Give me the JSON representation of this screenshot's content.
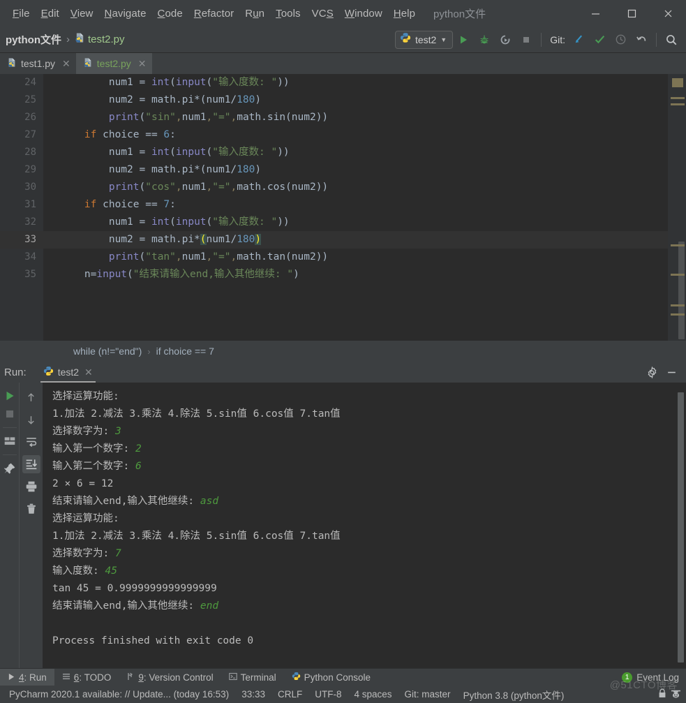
{
  "window": {
    "project_name": "python文件",
    "minimize_label": "Minimize",
    "maximize_label": "Maximize",
    "close_label": "Close"
  },
  "menu": [
    {
      "label": "File",
      "accel": "F"
    },
    {
      "label": "Edit",
      "accel": "E"
    },
    {
      "label": "View",
      "accel": "V"
    },
    {
      "label": "Navigate",
      "accel": "N"
    },
    {
      "label": "Code",
      "accel": "C"
    },
    {
      "label": "Refactor",
      "accel": "R"
    },
    {
      "label": "Run",
      "accel": "u"
    },
    {
      "label": "Tools",
      "accel": "T"
    },
    {
      "label": "VCS",
      "accel": "S"
    },
    {
      "label": "Window",
      "accel": "W"
    },
    {
      "label": "Help",
      "accel": "H"
    }
  ],
  "toolbar": {
    "breadcrumb_project": "python文件",
    "breadcrumb_sep": "›",
    "breadcrumb_file": "test2.py",
    "run_config_name": "test2",
    "run_config_caret": "▼",
    "git_label": "Git:",
    "buttons": {
      "run": "Run",
      "debug": "Debug",
      "run_coverage": "Run with Coverage",
      "stop": "Stop",
      "update_project": "Update Project",
      "commit": "Commit",
      "history": "History",
      "rollback": "Rollback",
      "search": "Search Everywhere"
    }
  },
  "editor_tabs": [
    {
      "label": "test1.py",
      "active": false,
      "close": "✕"
    },
    {
      "label": "test2.py",
      "active": true,
      "close": "✕"
    }
  ],
  "editor": {
    "first_line_number": 24,
    "current_line": 33,
    "lines": [
      {
        "n": 24,
        "html": "        num1 = int(input(\"输入度数: \"))",
        "clipped": true,
        "fold": "none"
      },
      {
        "n": 25,
        "html": "        num2 = math.pi*(num1/180)",
        "fold": "none"
      },
      {
        "n": 26,
        "html": "        print(\"sin\",num1,\"=\",math.sin(num2))",
        "fold": "end"
      },
      {
        "n": 27,
        "html": "    if choice == 6:",
        "fold": "start"
      },
      {
        "n": 28,
        "html": "        num1 = int(input(\"输入度数: \"))",
        "fold": "none"
      },
      {
        "n": 29,
        "html": "        num2 = math.pi*(num1/180)",
        "fold": "none"
      },
      {
        "n": 30,
        "html": "        print(\"cos\",num1,\"=\",math.cos(num2))",
        "fold": "end"
      },
      {
        "n": 31,
        "html": "    if choice == 7:",
        "fold": "start"
      },
      {
        "n": 32,
        "html": "        num1 = int(input(\"输入度数: \"))",
        "fold": "none"
      },
      {
        "n": 33,
        "html": "        num2 = math.pi*(num1/180)",
        "fold": "none",
        "highlight": true
      },
      {
        "n": 34,
        "html": "        print(\"tan\",num1,\"=\",math.tan(num2))",
        "fold": "end"
      },
      {
        "n": 35,
        "html": "    n=input(\"结束请输入end,输入其他继续: \")",
        "fold": "end"
      }
    ]
  },
  "breadcrumb_bar": {
    "items": [
      "while (n!=\"end\")",
      "if choice == 7"
    ],
    "separator": "›"
  },
  "run_panel": {
    "title": "Run:",
    "tab_label": "test2",
    "tab_close": "✕",
    "settings_label": "Settings",
    "hide_label": "Hide",
    "left_buttons": {
      "rerun": "Rerun",
      "stop": "Stop",
      "layout": "Layout Settings",
      "pin": "Pin Tab"
    },
    "side_buttons": {
      "up": "Up the stack trace",
      "down": "Down the stack trace",
      "soft_wrap": "Use Soft Wraps",
      "scroll_to_end": "Scroll to the end",
      "print": "Print",
      "clear": "Clear All"
    },
    "console": [
      {
        "segments": [
          {
            "t": "选择运算功能:",
            "c": "plain"
          }
        ]
      },
      {
        "segments": [
          {
            "t": "1.加法 2.减法 3.乘法 4.除法 5.sin值 6.cos值 7.tan值",
            "c": "plain"
          }
        ]
      },
      {
        "segments": [
          {
            "t": "选择数字为: ",
            "c": "plain"
          },
          {
            "t": "3",
            "c": "input"
          }
        ]
      },
      {
        "segments": [
          {
            "t": "输入第一个数字: ",
            "c": "plain"
          },
          {
            "t": "2",
            "c": "input"
          }
        ]
      },
      {
        "segments": [
          {
            "t": "输入第二个数字: ",
            "c": "plain"
          },
          {
            "t": "6",
            "c": "input"
          }
        ]
      },
      {
        "segments": [
          {
            "t": "2 × 6 = 12",
            "c": "plain"
          }
        ]
      },
      {
        "segments": [
          {
            "t": "结束请输入end,输入其他继续: ",
            "c": "plain"
          },
          {
            "t": "asd",
            "c": "input"
          }
        ]
      },
      {
        "segments": [
          {
            "t": "选择运算功能:",
            "c": "plain"
          }
        ]
      },
      {
        "segments": [
          {
            "t": "1.加法 2.减法 3.乘法 4.除法 5.sin值 6.cos值 7.tan值",
            "c": "plain"
          }
        ]
      },
      {
        "segments": [
          {
            "t": "选择数字为: ",
            "c": "plain"
          },
          {
            "t": "7",
            "c": "input"
          }
        ]
      },
      {
        "segments": [
          {
            "t": "输入度数: ",
            "c": "plain"
          },
          {
            "t": "45",
            "c": "input"
          }
        ]
      },
      {
        "segments": [
          {
            "t": "tan 45 = 0.9999999999999999",
            "c": "plain"
          }
        ]
      },
      {
        "segments": [
          {
            "t": "结束请输入end,输入其他继续: ",
            "c": "plain"
          },
          {
            "t": "end",
            "c": "input"
          }
        ]
      },
      {
        "segments": [
          {
            "t": "",
            "c": "plain"
          }
        ]
      },
      {
        "segments": [
          {
            "t": "Process finished with exit code 0",
            "c": "plain"
          }
        ]
      }
    ]
  },
  "tool_windows": [
    {
      "label": "4: Run",
      "accel": "4",
      "icon": "play-icon",
      "active": true
    },
    {
      "label": "6: TODO",
      "accel": "6",
      "icon": "list-icon",
      "active": false
    },
    {
      "label": "9: Version Control",
      "accel": "9",
      "icon": "branch-icon",
      "active": false
    },
    {
      "label": "Terminal",
      "accel": "",
      "icon": "terminal-icon",
      "active": false
    },
    {
      "label": "Python Console",
      "accel": "",
      "icon": "python-icon",
      "active": false
    }
  ],
  "event_log": {
    "label": "Event Log",
    "count": "1"
  },
  "status_bar": {
    "update_message": "PyCharm 2020.1 available: // Update... (today 16:53)",
    "caret_position": "33:33",
    "line_separator": "CRLF",
    "encoding": "UTF-8",
    "indent": "4 spaces",
    "branch": "Git: master",
    "interpreter": "Python 3.8 (python文件)",
    "lock_icon": "lock-icon",
    "inspector_icon": "hector-icon"
  },
  "watermark": "@51CTO博客",
  "colors": {
    "bg_chrome": "#3c3f41",
    "bg_editor": "#2b2b2b",
    "bg_gutter": "#313335",
    "accent_green": "#499c54",
    "keyword_orange": "#cc7832",
    "string_green": "#6a8759",
    "number_blue": "#6897bb",
    "function_yellow": "#ffc66d",
    "builtin_purple": "#8888c6",
    "default_text": "#a9b7c6"
  }
}
